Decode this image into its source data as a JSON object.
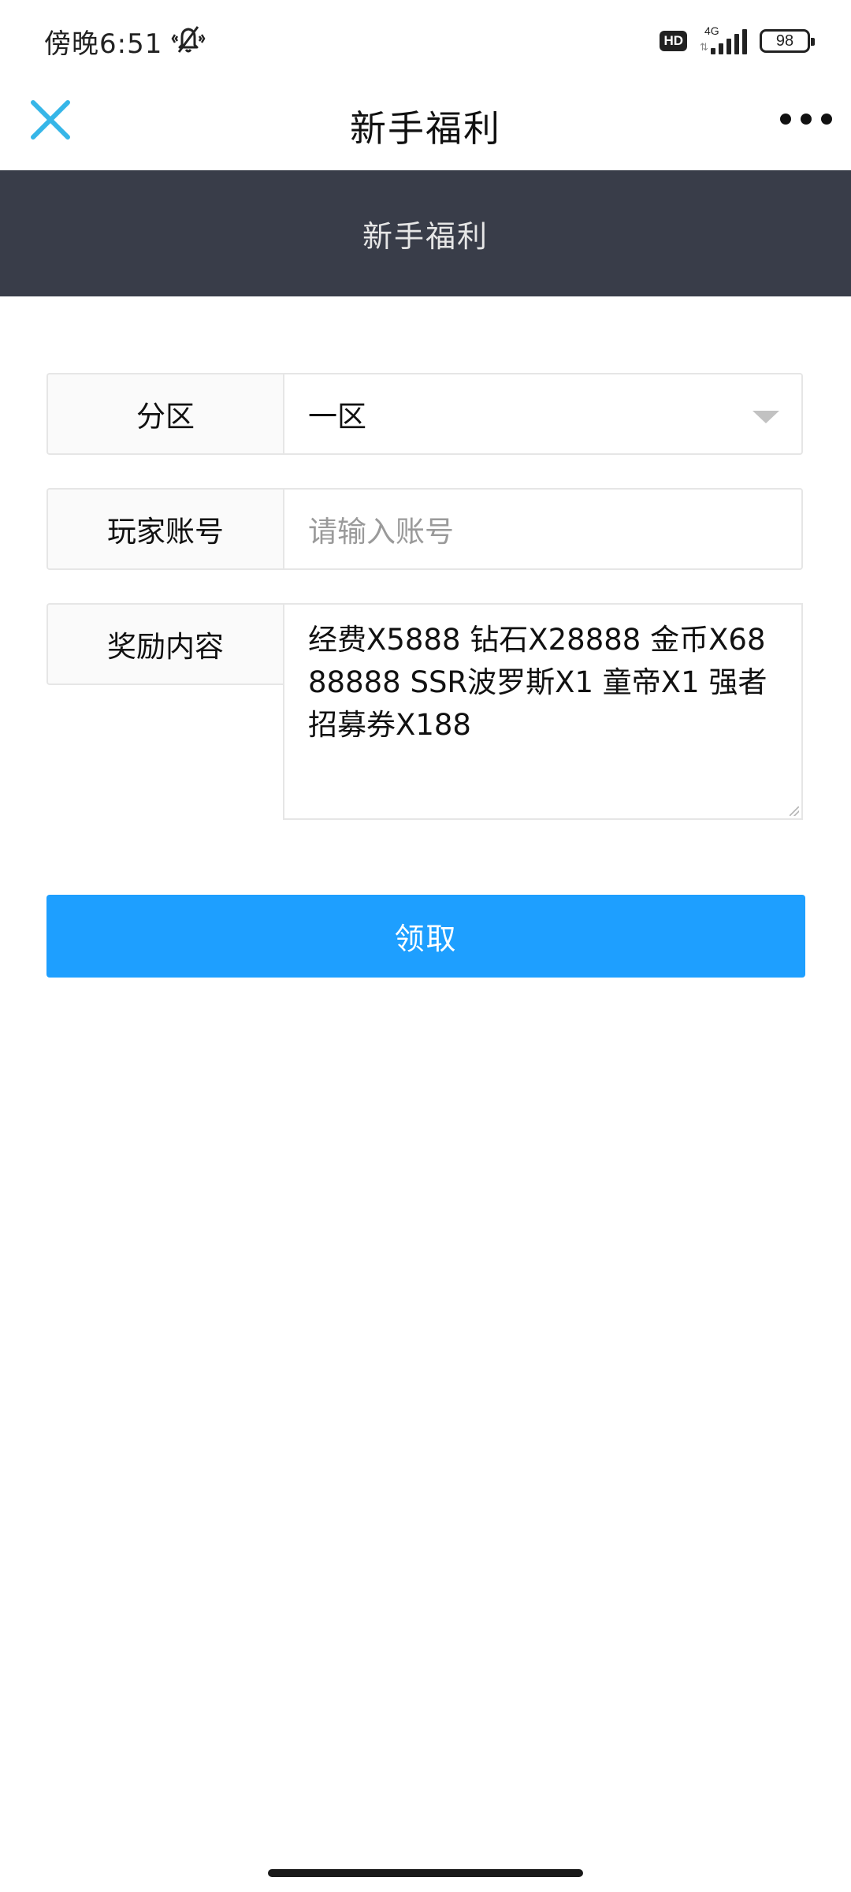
{
  "status_bar": {
    "time": "傍晚6:51",
    "mute_icon": "bell-slash-vibrate-icon",
    "hd_label": "HD",
    "network_label": "4G",
    "battery_level": "98"
  },
  "nav": {
    "close_icon": "close-icon",
    "title": "新手福利",
    "more_icon": "more-dots-icon"
  },
  "header": {
    "title": "新手福利"
  },
  "form": {
    "zone": {
      "label": "分区",
      "selected": "一区"
    },
    "account": {
      "label": "玩家账号",
      "placeholder": "请输入账号"
    },
    "reward": {
      "label": "奖励内容",
      "value": "经费X5888  钻石X28888  金币X6888888 SSR波罗斯X1 童帝X1 强者招募券X188"
    },
    "submit_label": "领取"
  },
  "colors": {
    "header_bg": "#393d49",
    "button_bg": "#1e9fff",
    "close_icon": "#36b6e8"
  }
}
